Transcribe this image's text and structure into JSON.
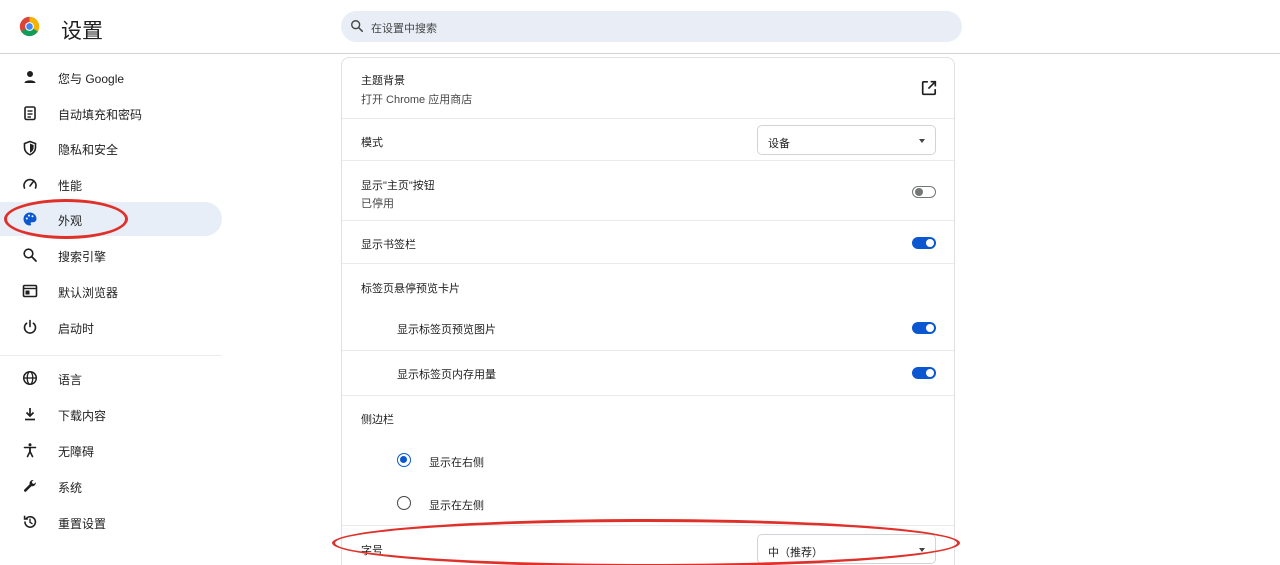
{
  "app": {
    "title": "设置",
    "search_placeholder": "在设置中搜索"
  },
  "sidebar": {
    "items": [
      {
        "label": "您与 Google",
        "icon": "person-icon"
      },
      {
        "label": "自动填充和密码",
        "icon": "clipboard-icon"
      },
      {
        "label": "隐私和安全",
        "icon": "shield-icon"
      },
      {
        "label": "性能",
        "icon": "speedometer-icon"
      },
      {
        "label": "外观",
        "icon": "palette-icon",
        "active": true
      },
      {
        "label": "搜索引擎",
        "icon": "search-icon"
      },
      {
        "label": "默认浏览器",
        "icon": "browser-icon"
      },
      {
        "label": "启动时",
        "icon": "power-icon"
      },
      {
        "label": "语言",
        "icon": "globe-icon"
      },
      {
        "label": "下载内容",
        "icon": "download-icon"
      },
      {
        "label": "无障碍",
        "icon": "accessibility-icon"
      },
      {
        "label": "系统",
        "icon": "wrench-icon"
      },
      {
        "label": "重置设置",
        "icon": "reset-icon"
      }
    ]
  },
  "appearance": {
    "theme": {
      "label": "主题背景",
      "sublabel": "打开 Chrome 应用商店"
    },
    "mode": {
      "label": "模式",
      "value": "设备"
    },
    "home_button": {
      "label": "显示\"主页\"按钮",
      "sublabel": "已停用",
      "enabled": false
    },
    "bookmarks_bar": {
      "label": "显示书签栏",
      "enabled": true
    },
    "tab_hover": {
      "label": "标签页悬停预览卡片"
    },
    "tab_preview_image": {
      "label": "显示标签页预览图片",
      "enabled": true
    },
    "tab_memory": {
      "label": "显示标签页内存用量",
      "enabled": true
    },
    "side_panel": {
      "label": "侧边栏",
      "options": [
        {
          "label": "显示在右侧",
          "checked": true
        },
        {
          "label": "显示在左侧",
          "checked": false
        }
      ]
    },
    "font_size": {
      "label": "字号",
      "value": "中（推荐）"
    }
  },
  "colors": {
    "accent": "#0b57d0",
    "annotation": "#e0302a",
    "active_bg": "#e8eef8"
  }
}
